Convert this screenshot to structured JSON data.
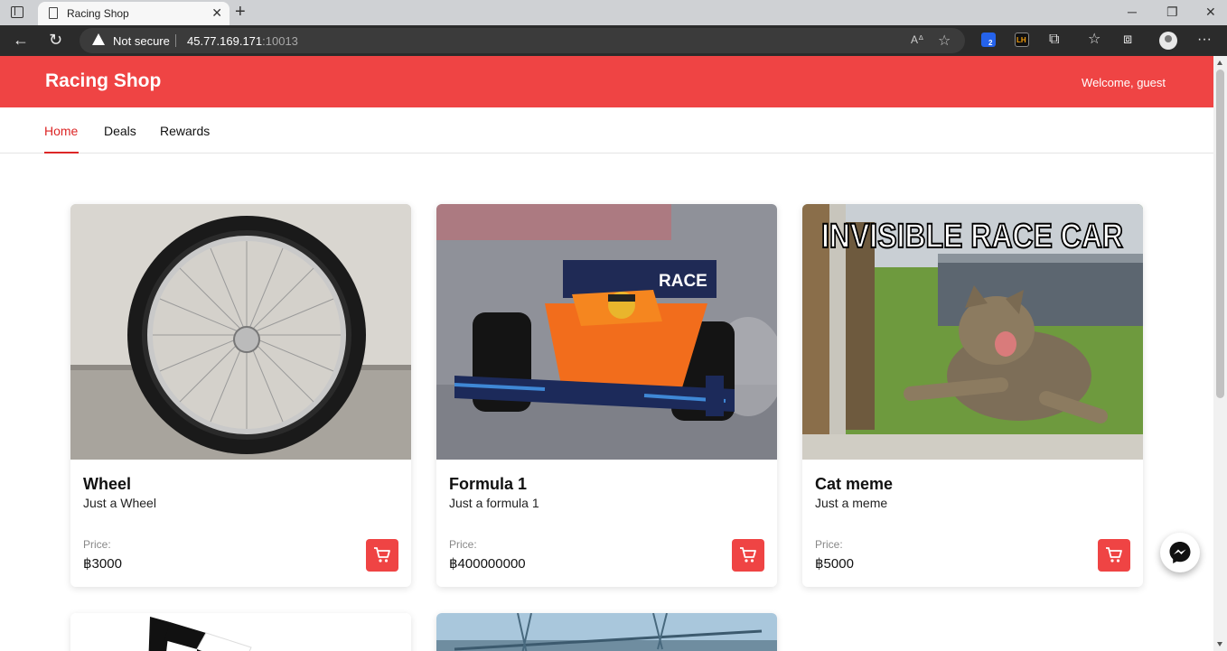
{
  "browser": {
    "tab_title": "Racing Shop",
    "security_label": "Not secure",
    "url_host": "45.77.169.171",
    "url_port": ":10013",
    "extension_badge": "2",
    "extension_lh": "LH"
  },
  "header": {
    "brand": "Racing Shop",
    "welcome": "Welcome, guest"
  },
  "nav": {
    "items": [
      {
        "label": "Home",
        "active": true
      },
      {
        "label": "Deals",
        "active": false
      },
      {
        "label": "Rewards",
        "active": false
      }
    ]
  },
  "products": [
    {
      "name": "Wheel",
      "description": "Just a Wheel",
      "price_label": "Price:",
      "price": "฿3000",
      "image": "wheel-photo"
    },
    {
      "name": "Formula 1",
      "description": "Just a formula 1",
      "price_label": "Price:",
      "price": "฿400000000",
      "image": "formula1-car-photo"
    },
    {
      "name": "Cat meme",
      "description": "Just a meme",
      "price_label": "Price:",
      "price": "฿5000",
      "image": "cat-meme-photo",
      "image_caption": "INVISIBLE RACE CAR"
    }
  ],
  "formula1_livery_text": "RACE",
  "colors": {
    "accent": "#ef4444",
    "active_nav": "#dc2626"
  }
}
